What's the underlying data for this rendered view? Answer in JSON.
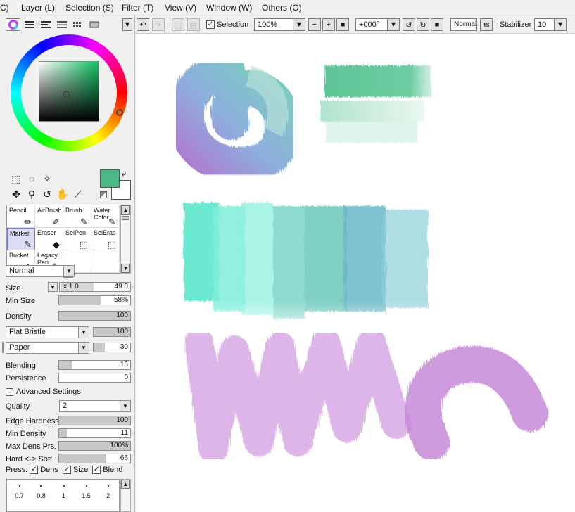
{
  "menu": [
    "C)",
    "Layer (L)",
    "Selection (S)",
    "Filter (T)",
    "View (V)",
    "Window (W)",
    "Others (O)"
  ],
  "colors": {
    "accent": "#4bb888",
    "panel_bg": "#f0f0f0",
    "canvas_bg": "#ffffff",
    "stroke_teal": "#5cc8a8",
    "stroke_green": "#4bc08a",
    "stroke_aqua": "#63e8cf",
    "stroke_blue": "#6ab8c8",
    "stroke_purple": "#c58ad8"
  },
  "toolbar": {
    "selection_label": "Selection",
    "zoom": "100%",
    "rotation": "+000°",
    "blend_mode": "Normal",
    "stabilizer_label": "Stabilizer",
    "stabilizer_value": "10"
  },
  "brushes": [
    {
      "label": "Pencil",
      "icon": "pencil-icon"
    },
    {
      "label": "AirBrush",
      "icon": "airbrush-icon"
    },
    {
      "label": "Brush",
      "icon": "brush-icon"
    },
    {
      "label": "Water Color",
      "icon": "watercolor-icon"
    },
    {
      "label": "Marker",
      "icon": "marker-icon"
    },
    {
      "label": "Eraser",
      "icon": "eraser-icon"
    },
    {
      "label": "SelPen",
      "icon": "selpen-icon"
    },
    {
      "label": "SelEras",
      "icon": "seleras-icon"
    },
    {
      "label": "Bucket",
      "icon": "bucket-icon"
    },
    {
      "label": "Legacy Pen",
      "icon": "legacy-pen-icon"
    },
    {
      "label": "",
      "icon": ""
    },
    {
      "label": "",
      "icon": ""
    }
  ],
  "brush_settings": {
    "blend": "Normal",
    "size_label": "Size",
    "size_multiplier": "x 1.0",
    "size_value": "49.0",
    "min_size_label": "Min Size",
    "min_size_value": "58%",
    "min_size_fraction": 0.58,
    "density_label": "Density",
    "density_value": "100",
    "density_fraction": 1.0,
    "bristle": "Flat Bristle",
    "bristle_value": "100",
    "bristle_fraction": 1.0,
    "texture": "Paper",
    "texture_value": "30",
    "texture_fraction": 0.3,
    "blending_label": "Blending",
    "blending_value": "18",
    "blending_fraction": 0.18,
    "persistence_label": "Persistence",
    "persistence_value": "0",
    "persistence_fraction": 0.0
  },
  "advanced": {
    "header": "Advanced Settings",
    "quality_label": "Quailty",
    "quality_value": "2",
    "edge_hardness_label": "Edge Hardness",
    "edge_hardness_value": "100",
    "edge_hardness_fraction": 1.0,
    "min_density_label": "Min Density",
    "min_density_value": "11",
    "min_density_fraction": 0.11,
    "max_dens_label": "Max Dens Prs.",
    "max_dens_value": "100%",
    "max_dens_fraction": 1.0,
    "hard_soft_label": "Hard <-> Soft",
    "hard_soft_value": "66",
    "hard_soft_fraction": 0.66,
    "press_label": "Press:",
    "press_dens": "Dens",
    "press_size": "Size",
    "press_blend": "Blend"
  },
  "size_presets": [
    "0.7",
    "0.8",
    "1",
    "1.5",
    "2"
  ]
}
